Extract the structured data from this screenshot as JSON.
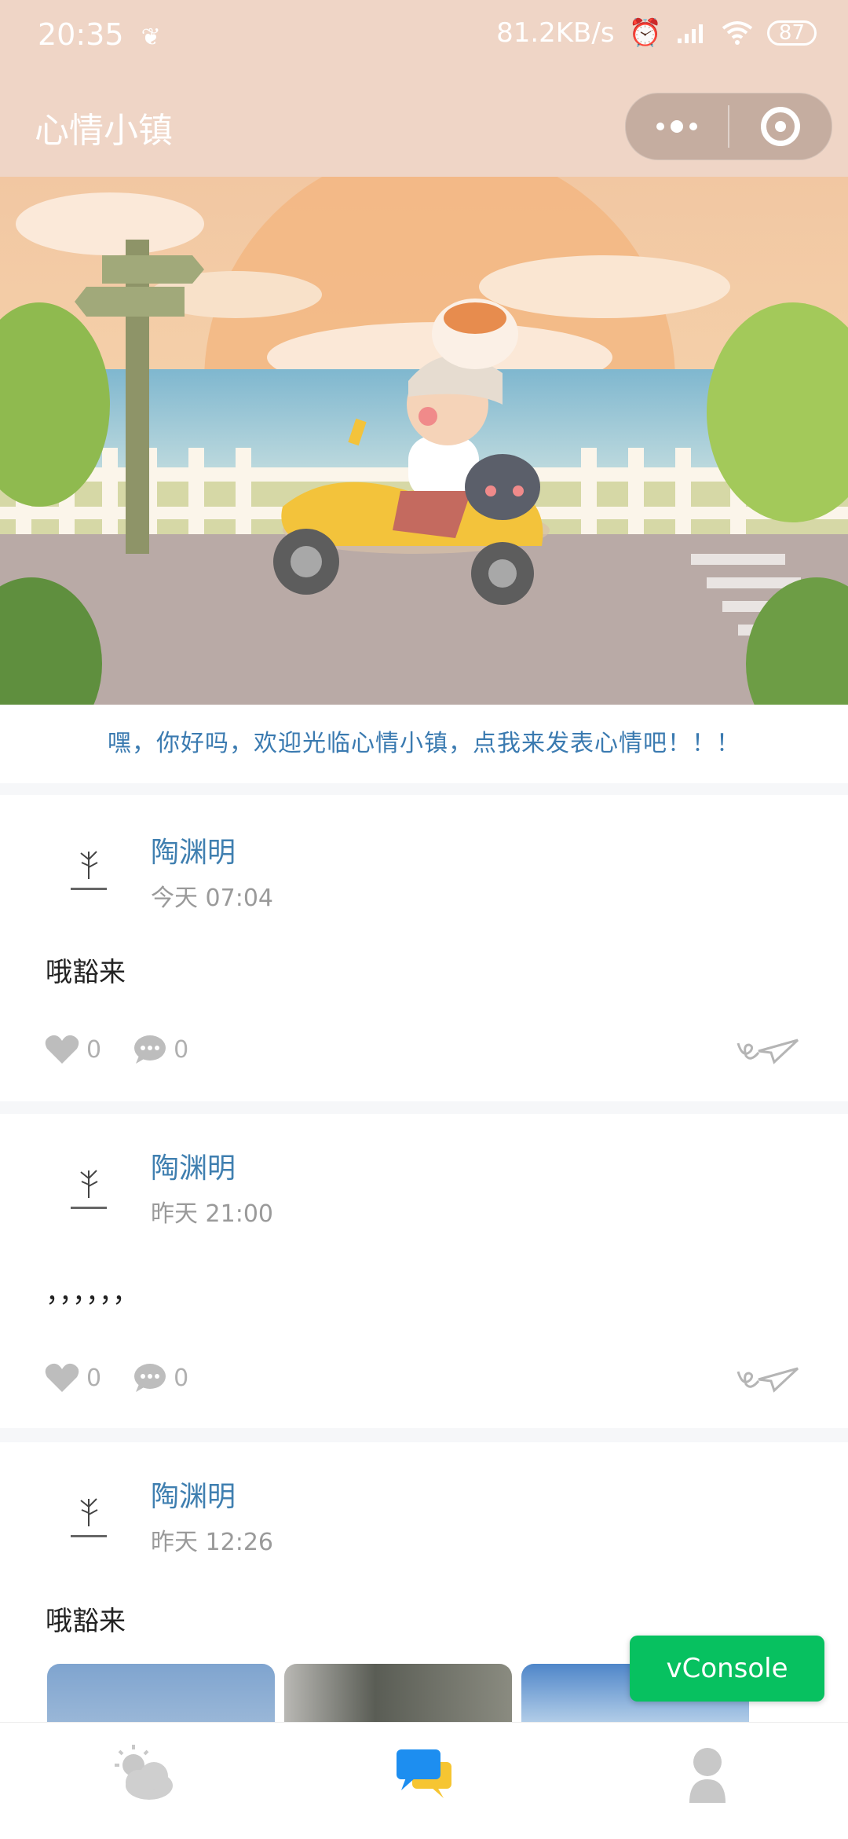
{
  "status_bar": {
    "time": "20:35",
    "net_speed": "81.2KB/s",
    "battery": "87"
  },
  "nav": {
    "title": "心情小镇"
  },
  "welcome": "嘿，你好吗，欢迎光临心情小镇，点我来发表心情吧！！！",
  "posts": [
    {
      "author": "陶渊明",
      "time": "今天 07:04",
      "text": "哦豁来",
      "likes": "0",
      "comments": "0"
    },
    {
      "author": "陶渊明",
      "time": "昨天 21:00",
      "text": "，，，，，，",
      "likes": "0",
      "comments": "0"
    },
    {
      "author": "陶渊明",
      "time": "昨天 12:26",
      "text": "哦豁来"
    }
  ],
  "vconsole_label": "vConsole",
  "colors": {
    "header_bg": "#efd5c6",
    "accent_blue": "#3f7fb0",
    "vconsole_green": "#07c160",
    "tab_active": "#1d8ef0"
  },
  "tabs": [
    "weather-icon",
    "chat-bubbles-icon",
    "user-icon"
  ]
}
